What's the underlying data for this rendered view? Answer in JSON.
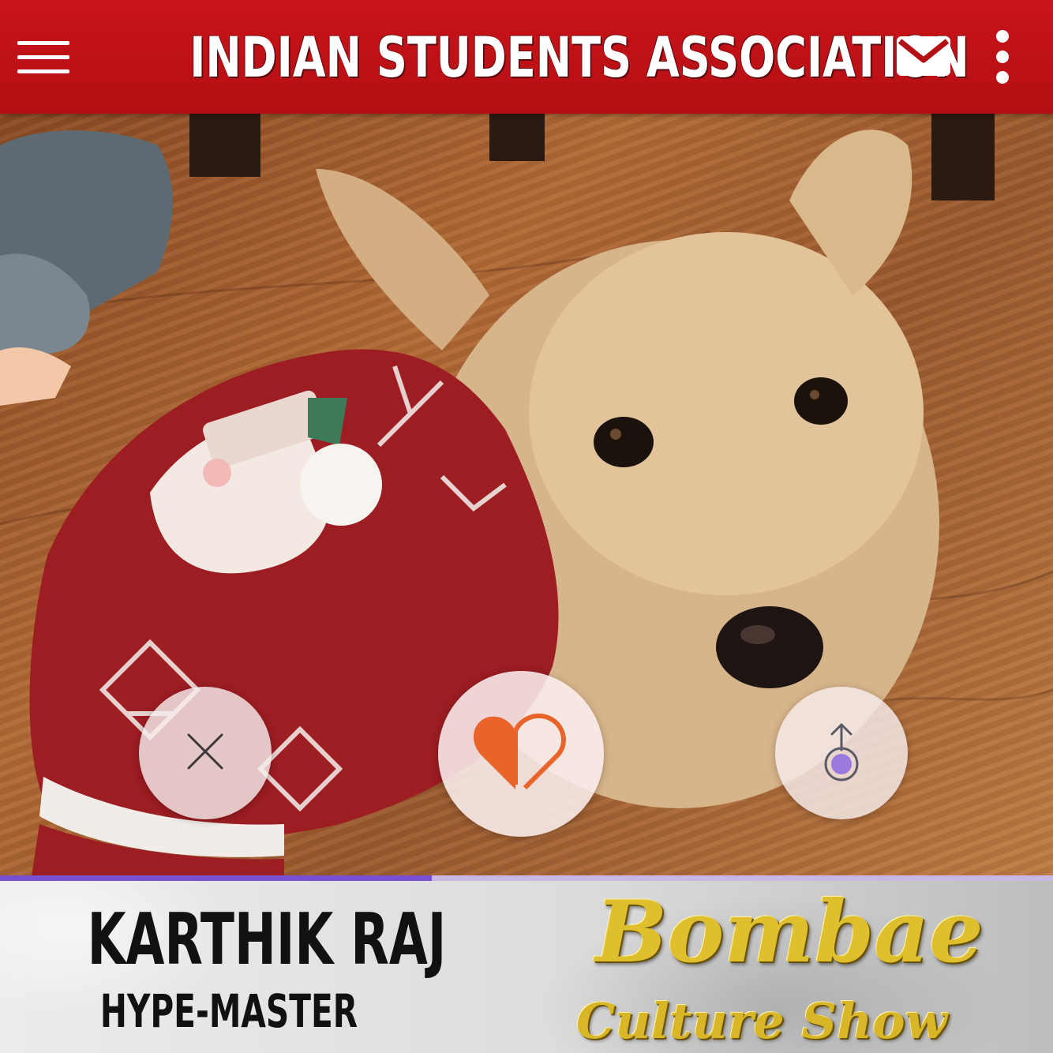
{
  "app_bar": {
    "title": "INDIAN STUDENTS ASSOCIATION",
    "icons": [
      "menu-icon",
      "mail-icon",
      "more-vertical-icon"
    ],
    "background_color": "#b40f14"
  },
  "photo": {
    "subject": "dog-photo"
  },
  "actions": {
    "icons": [
      "close-icon",
      "heart-icon",
      "share-icon"
    ],
    "heart_color": "#e8642a",
    "share_dot_color": "#9b7ae0"
  },
  "progress": {
    "fraction": 0.41,
    "color": "#7a4fd0"
  },
  "profile": {
    "name": "KARTHIK RAJ",
    "role": "HYPE-MASTER"
  },
  "event": {
    "title": "Bombae",
    "subtitle": "Culture Show",
    "text_color": "#e0bf2e"
  }
}
